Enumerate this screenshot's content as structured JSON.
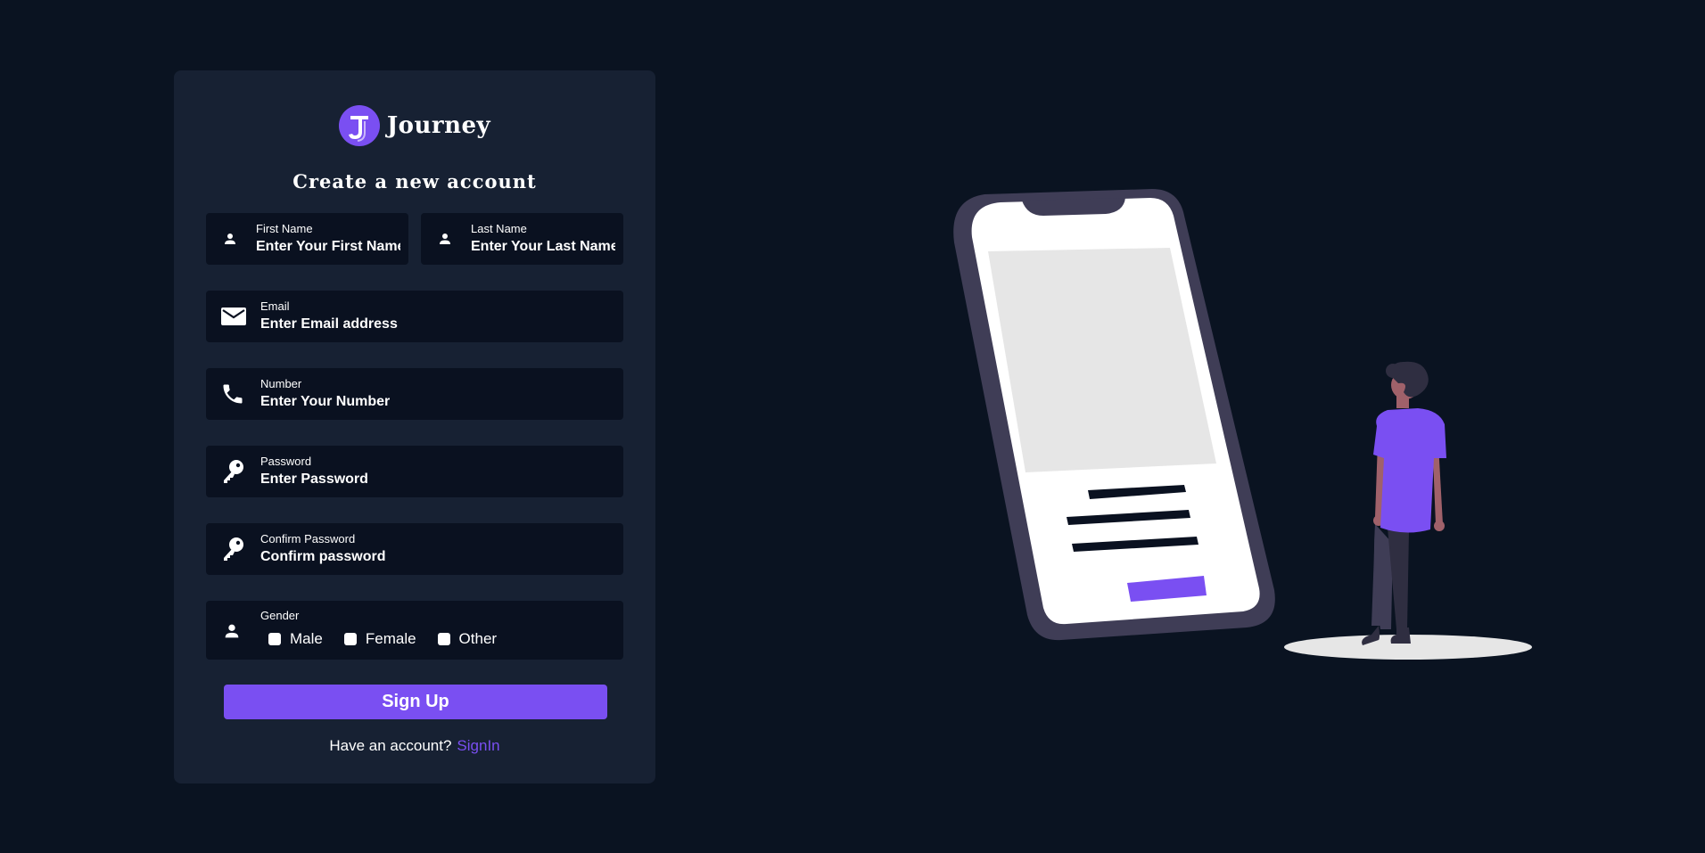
{
  "brand": {
    "name": "Journey",
    "accent": "#7a4ff2",
    "icon": "journey-logo-icon"
  },
  "form": {
    "heading": "Create a new account",
    "first_name": {
      "label": "First Name",
      "placeholder": "Enter Your First Name",
      "icon": "user-icon"
    },
    "last_name": {
      "label": "Last Name",
      "placeholder": "Enter Your Last Name",
      "icon": "user-icon"
    },
    "email": {
      "label": "Email",
      "placeholder": "Enter Email address",
      "icon": "mail-icon"
    },
    "number": {
      "label": "Number",
      "placeholder": "Enter Your Number",
      "icon": "phone-icon"
    },
    "password": {
      "label": "Password",
      "placeholder": "Enter Password",
      "icon": "key-icon"
    },
    "confirm_password": {
      "label": "Confirm Password",
      "placeholder": "Confirm password",
      "icon": "key-icon"
    },
    "gender": {
      "label": "Gender",
      "icon": "user-icon",
      "options": [
        "Male",
        "Female",
        "Other"
      ]
    },
    "submit_label": "Sign Up",
    "footer_text": "Have an account?",
    "signin_label": "SignIn"
  },
  "colors": {
    "page_bg": "#0a1321",
    "card_bg": "#172133",
    "field_bg": "#0a1120",
    "accent": "#7a4ff2"
  }
}
